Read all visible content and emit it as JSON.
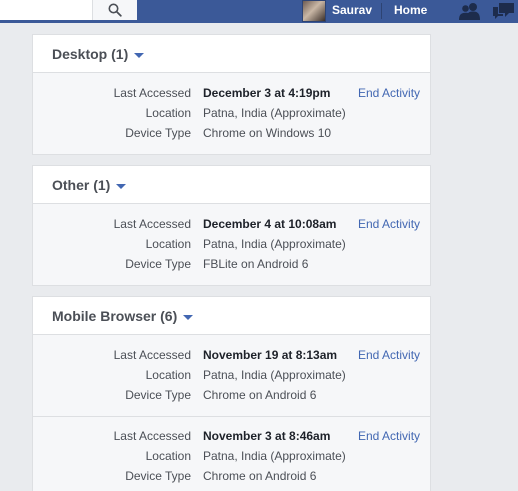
{
  "topbar": {
    "search_placeholder": "",
    "user_name": "Saurav",
    "home_label": "Home",
    "icons": [
      "search-icon",
      "friends-icon",
      "messages-icon"
    ]
  },
  "colors": {
    "brand_blue": "#3b5998",
    "link_blue": "#4267b2",
    "page_bg": "#e9ebee"
  },
  "labels": {
    "last_accessed": "Last Accessed",
    "location": "Location",
    "device_type": "Device Type",
    "end_activity": "End Activity"
  },
  "groups": [
    {
      "title": "Desktop (1)",
      "sessions": [
        {
          "last_accessed": "December 3 at 4:19pm",
          "location": "Patna, India (Approximate)",
          "device_type": "Chrome on Windows 10"
        }
      ]
    },
    {
      "title": "Other (1)",
      "sessions": [
        {
          "last_accessed": "December 4 at 10:08am",
          "location": "Patna, India (Approximate)",
          "device_type": "FBLite on Android 6"
        }
      ]
    },
    {
      "title": "Mobile Browser (6)",
      "sessions": [
        {
          "last_accessed": "November 19 at 8:13am",
          "location": "Patna, India (Approximate)",
          "device_type": "Chrome on Android 6"
        },
        {
          "last_accessed": "November 3 at 8:46am",
          "location": "Patna, India (Approximate)",
          "device_type": "Chrome on Android 6"
        }
      ]
    }
  ]
}
